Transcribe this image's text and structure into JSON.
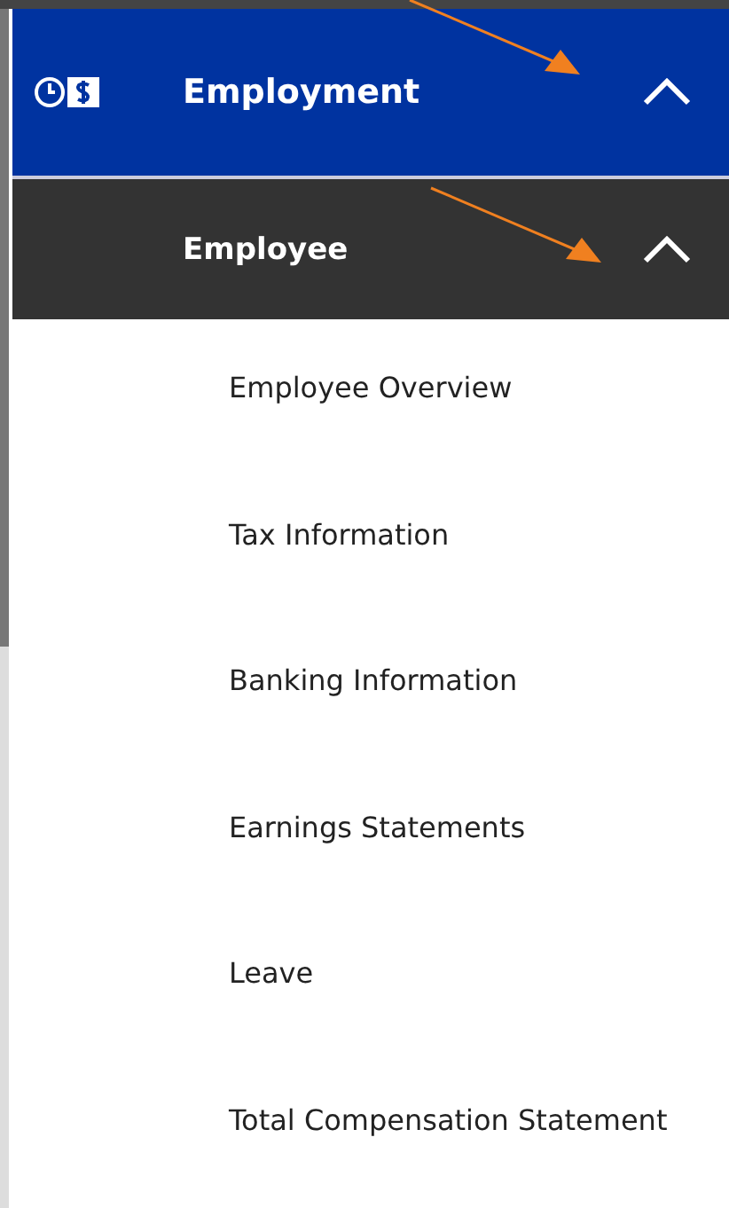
{
  "section": {
    "label": "Employment",
    "expanded": true
  },
  "subsection": {
    "label": "Employee",
    "expanded": true
  },
  "items": [
    {
      "label": "Employee Overview"
    },
    {
      "label": "Tax Information"
    },
    {
      "label": "Banking Information"
    },
    {
      "label": "Earnings Statements"
    },
    {
      "label": "Leave"
    },
    {
      "label": "Total Compensation Statement"
    }
  ]
}
